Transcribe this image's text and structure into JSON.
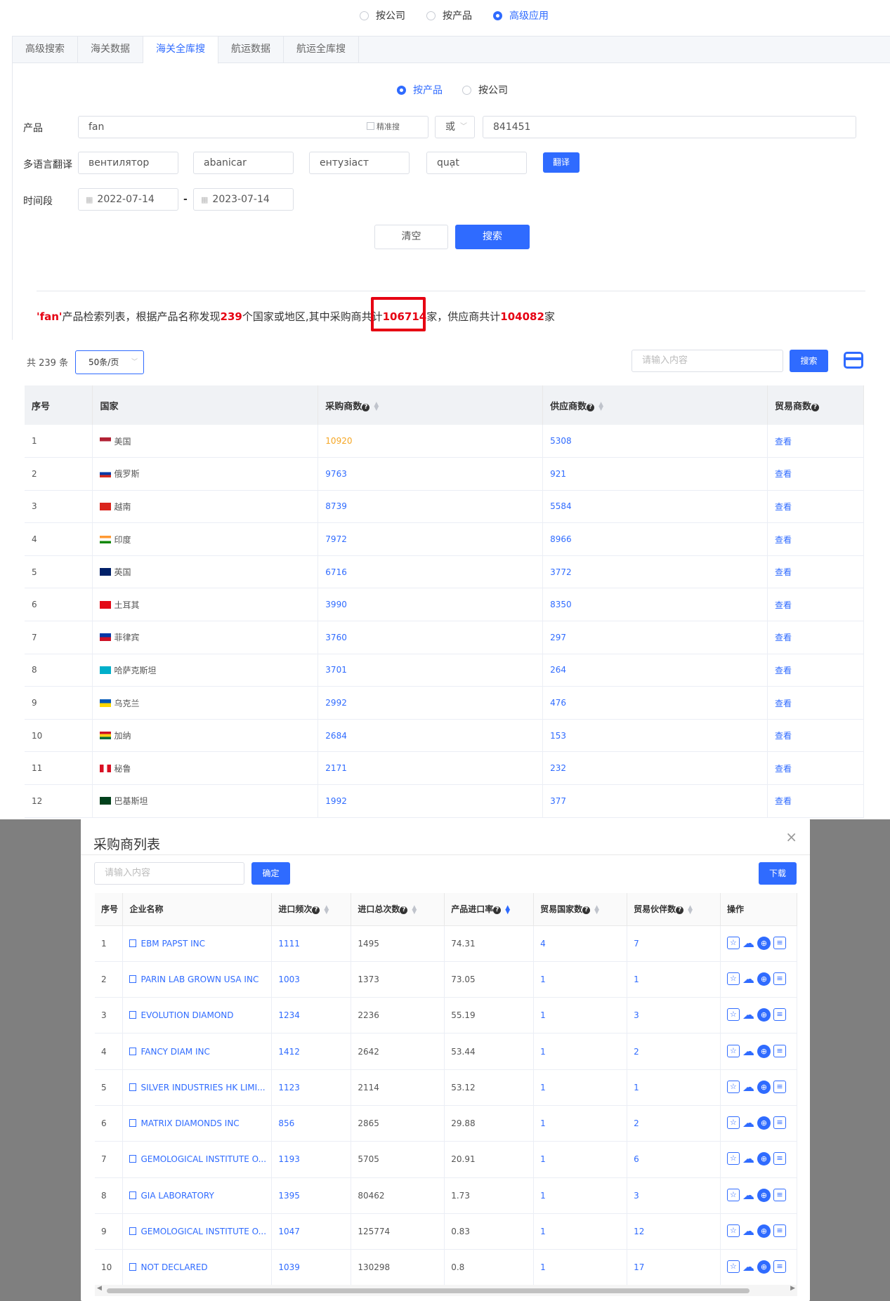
{
  "top_modes": {
    "items": [
      "按公司",
      "按产品",
      "高级应用"
    ],
    "selected": "高级应用"
  },
  "tabs": [
    "高级搜索",
    "海关数据",
    "海关全库搜",
    "航运数据",
    "航运全库搜"
  ],
  "active_tab": "海关全库搜",
  "search_mode": {
    "items": [
      "按产品",
      "按公司"
    ],
    "selected": "按产品"
  },
  "form": {
    "product_label": "产品",
    "product_value": "fan",
    "exact_label": "精准搜",
    "logic_value": "或",
    "hs_value": "841451",
    "translate_label": "多语言翻译",
    "translations": [
      "вентилятор",
      "abanicar",
      "ентузіаст",
      "quạt"
    ],
    "translate_button": "翻译",
    "date_label": "时间段",
    "date_from": "2022-07-14",
    "date_to": "2023-07-14",
    "date_sep": "-",
    "clear_button": "清空",
    "search_button": "搜索"
  },
  "summary": {
    "p1": "'fan'",
    "p2": "产品检索列表，根据产品名称发现",
    "countries": "239",
    "p3": "个国家或地区,其中采购商共计",
    "buyers": "106714",
    "p4": "家，供应商共计",
    "suppliers": "104082",
    "p5": "家"
  },
  "list": {
    "total": "共 239 条",
    "page_size": "50条/页",
    "search_placeholder": "请输入内容",
    "search_button": "搜索"
  },
  "country_table": {
    "headers": [
      "序号",
      "国家",
      "采购商数",
      "供应商数",
      "贸易商数"
    ],
    "rows": [
      {
        "no": "1",
        "country": "美国",
        "buyers": "10920",
        "suppliers": "5308",
        "trade": "查看"
      },
      {
        "no": "2",
        "country": "俄罗斯",
        "buyers": "9763",
        "suppliers": "921",
        "trade": "查看"
      },
      {
        "no": "3",
        "country": "越南",
        "buyers": "8739",
        "suppliers": "5584",
        "trade": "查看"
      },
      {
        "no": "4",
        "country": "印度",
        "buyers": "7972",
        "suppliers": "8966",
        "trade": "查看"
      },
      {
        "no": "5",
        "country": "英国",
        "buyers": "6716",
        "suppliers": "3772",
        "trade": "查看"
      },
      {
        "no": "6",
        "country": "土耳其",
        "buyers": "3990",
        "suppliers": "8350",
        "trade": "查看"
      },
      {
        "no": "7",
        "country": "菲律宾",
        "buyers": "3760",
        "suppliers": "297",
        "trade": "查看"
      },
      {
        "no": "8",
        "country": "哈萨克斯坦",
        "buyers": "3701",
        "suppliers": "264",
        "trade": "查看"
      },
      {
        "no": "9",
        "country": "乌克兰",
        "buyers": "2992",
        "suppliers": "476",
        "trade": "查看"
      },
      {
        "no": "10",
        "country": "加纳",
        "buyers": "2684",
        "suppliers": "153",
        "trade": "查看"
      },
      {
        "no": "11",
        "country": "秘鲁",
        "buyers": "2171",
        "suppliers": "232",
        "trade": "查看"
      },
      {
        "no": "12",
        "country": "巴基斯坦",
        "buyers": "1992",
        "suppliers": "377",
        "trade": "查看"
      }
    ]
  },
  "modal": {
    "title": "采购商列表",
    "search_placeholder": "请输入内容",
    "confirm_button": "确定",
    "download_button": "下载",
    "headers": [
      "序号",
      "企业名称",
      "进口频次",
      "进口总次数",
      "产品进口率",
      "贸易国家数",
      "贸易伙伴数",
      "操作"
    ],
    "rows": [
      {
        "no": "1",
        "name": "EBM PAPST INC",
        "freq": "1111",
        "total": "1495",
        "rate": "74.31",
        "countries": "4",
        "partners": "7"
      },
      {
        "no": "2",
        "name": "PARIN LAB GROWN USA INC",
        "freq": "1003",
        "total": "1373",
        "rate": "73.05",
        "countries": "1",
        "partners": "1"
      },
      {
        "no": "3",
        "name": "EVOLUTION DIAMOND",
        "freq": "1234",
        "total": "2236",
        "rate": "55.19",
        "countries": "1",
        "partners": "3"
      },
      {
        "no": "4",
        "name": "FANCY DIAM INC",
        "freq": "1412",
        "total": "2642",
        "rate": "53.44",
        "countries": "1",
        "partners": "2"
      },
      {
        "no": "5",
        "name": "SILVER INDUSTRIES HK LIMI...",
        "freq": "1123",
        "total": "2114",
        "rate": "53.12",
        "countries": "1",
        "partners": "1"
      },
      {
        "no": "6",
        "name": "MATRIX DIAMONDS INC",
        "freq": "856",
        "total": "2865",
        "rate": "29.88",
        "countries": "1",
        "partners": "2"
      },
      {
        "no": "7",
        "name": "GEMOLOGICAL INSTITUTE O...",
        "freq": "1193",
        "total": "5705",
        "rate": "20.91",
        "countries": "1",
        "partners": "6"
      },
      {
        "no": "8",
        "name": "GIA LABORATORY",
        "freq": "1395",
        "total": "80462",
        "rate": "1.73",
        "countries": "1",
        "partners": "3"
      },
      {
        "no": "9",
        "name": "GEMOLOGICAL INSTITUTE O...",
        "freq": "1047",
        "total": "125774",
        "rate": "0.83",
        "countries": "1",
        "partners": "12"
      },
      {
        "no": "10",
        "name": "NOT DECLARED",
        "freq": "1039",
        "total": "130298",
        "rate": "0.8",
        "countries": "1",
        "partners": "17"
      }
    ]
  },
  "colors": {
    "accent": "#2f6bff",
    "highlight": "#e60012",
    "orange": "#f5a623"
  }
}
